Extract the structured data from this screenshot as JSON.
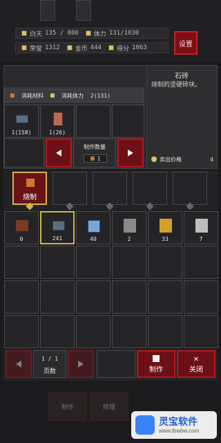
{
  "stats": {
    "day_label": "白天",
    "day_value": "135 / 800",
    "stamina_label": "体力",
    "stamina_value": "131/1030",
    "honor_label": "荣誉",
    "honor_value": "1312",
    "gold_label": "金币",
    "gold_value": "444",
    "score_label": "得分",
    "score_value": "1063"
  },
  "settings": {
    "label": "设置"
  },
  "detail": {
    "title": "石砖",
    "desc": "烧制的坚硬砖块。",
    "consume_materials": "消耗材料",
    "consume_stamina": "消耗体力",
    "stamina_cost": "2(131)",
    "sell_price_label": "卖出价格",
    "sell_price_value": "4"
  },
  "materials": [
    {
      "count": "1(158)"
    },
    {
      "count": "1(26)"
    }
  ],
  "production": {
    "label": "制作数量",
    "value": "1"
  },
  "tabs": {
    "active_label": "烧制"
  },
  "inventory": [
    {
      "icon": "chest-icon",
      "count": "0"
    },
    {
      "icon": "brick-icon",
      "count": "241"
    },
    {
      "icon": "glass-icon",
      "count": "40"
    },
    {
      "icon": "gate-gray-icon",
      "count": "2"
    },
    {
      "icon": "gate-gold-icon",
      "count": "33"
    },
    {
      "icon": "shield-icon",
      "count": "7"
    }
  ],
  "pagination": {
    "current": "1 / 1",
    "label": "页数"
  },
  "actions": {
    "craft": "制作",
    "close": "关闭"
  },
  "bottom_ghost": {
    "craft": "制作",
    "repair": "修理"
  },
  "watermark": {
    "brand": "灵宝软件",
    "site": "www.lbwbw.com"
  },
  "colors": {
    "accent_red": "#b6181f",
    "accent_gold": "#d4b24a",
    "panel": "#2b2b2e"
  }
}
